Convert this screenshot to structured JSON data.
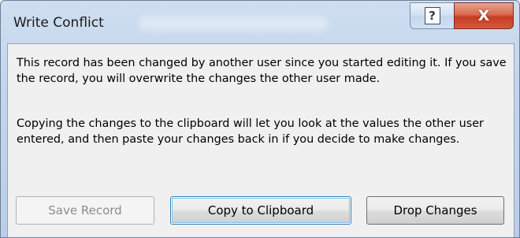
{
  "window": {
    "title": "Write Conflict"
  },
  "caption_buttons": {
    "help_glyph": "?",
    "close_glyph": "X"
  },
  "message": {
    "paragraph1": "This record has been changed by another user since you started editing it. If you save the record, you will overwrite the changes the other user made.",
    "paragraph2": "Copying the changes to the clipboard will let you look at the values the other user entered, and then paste your changes back in if you decide to make changes."
  },
  "buttons": {
    "save_record": "Save Record",
    "copy_to_clipboard": "Copy to Clipboard",
    "drop_changes": "Drop Changes"
  },
  "state": {
    "save_record_disabled": true,
    "default_button": "copy_to_clipboard"
  },
  "colors": {
    "titlebar": "#c2d5ec",
    "dialog_body": "#f0f0f0",
    "close_button": "#c43c22",
    "default_button_outline": "#3c7fb1"
  }
}
